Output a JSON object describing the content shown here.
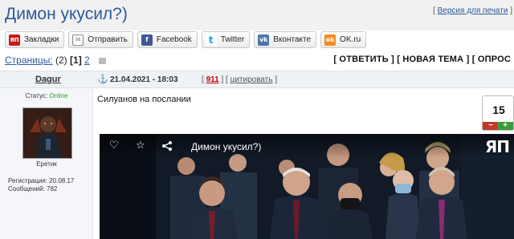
{
  "topic": {
    "title": "Димон укусил?)",
    "print_version": "Версия для печати"
  },
  "share": [
    {
      "label": "Закладки",
      "icon": "yap-bookmark-icon",
      "glyph": "ЯП"
    },
    {
      "label": "Отправить",
      "icon": "mail-icon",
      "glyph": "✉"
    },
    {
      "label": "Facebook",
      "icon": "facebook-icon",
      "glyph": "f"
    },
    {
      "label": "Twitter",
      "icon": "twitter-icon",
      "glyph": "t"
    },
    {
      "label": "Вконтакте",
      "icon": "vk-icon",
      "glyph": "vk"
    },
    {
      "label": "OK.ru",
      "icon": "ok-icon",
      "glyph": "ok"
    }
  ],
  "pages": {
    "label": "Страницы:",
    "count": "(2)",
    "current": "[1]",
    "next": "2"
  },
  "actions": {
    "reply": "[ ОТВЕТИТЬ ]",
    "new_topic": "[ НОВАЯ ТЕМА ]",
    "poll": "[ ОПРОС"
  },
  "post": {
    "author": "Dagur",
    "date": "21.04.2021 - 18:03",
    "number": "911",
    "quote": "цитировать",
    "text": "Силуанов на послании",
    "rating": "15",
    "rating_minus": "−",
    "rating_plus": "+"
  },
  "user": {
    "status_label": "Статус:",
    "status_value": "Online",
    "rank": "Еретик",
    "registered": "Регистрация: 20.08.17",
    "messages": "Сообщений: 782"
  },
  "video": {
    "title": "Димон укусил?)",
    "logo": "ЯП"
  },
  "colors": {
    "link": "#2a5a9c",
    "online": "#2aa52a",
    "post_number": "#cc0000"
  }
}
